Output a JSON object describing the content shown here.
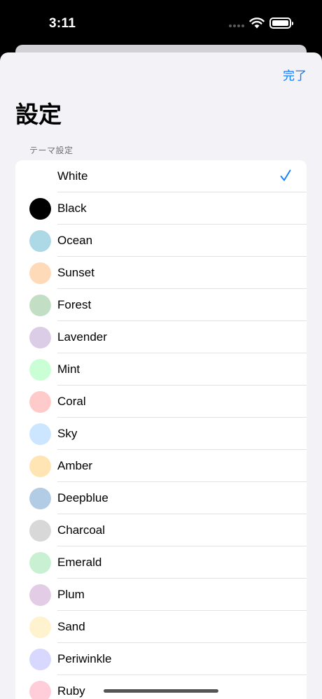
{
  "status_bar": {
    "time": "3:11"
  },
  "sheet": {
    "done_label": "完了",
    "title": "設定",
    "section_header": "テーマ設定"
  },
  "themes": [
    {
      "name": "White",
      "color": "#ffffff",
      "selected": true
    },
    {
      "name": "Black",
      "color": "#000000"
    },
    {
      "name": "Ocean",
      "color": "#add8e6"
    },
    {
      "name": "Sunset",
      "color": "#ffdab9"
    },
    {
      "name": "Forest",
      "color": "#c2dfc6"
    },
    {
      "name": "Lavender",
      "color": "#dccde6"
    },
    {
      "name": "Mint",
      "color": "#caffd6"
    },
    {
      "name": "Coral",
      "color": "#ffcaca"
    },
    {
      "name": "Sky",
      "color": "#cce6ff"
    },
    {
      "name": "Amber",
      "color": "#ffe5b4"
    },
    {
      "name": "Deepblue",
      "color": "#b3cce6"
    },
    {
      "name": "Charcoal",
      "color": "#d8d8d8"
    },
    {
      "name": "Emerald",
      "color": "#c9f0d2"
    },
    {
      "name": "Plum",
      "color": "#e3cce6"
    },
    {
      "name": "Sand",
      "color": "#fff3cf"
    },
    {
      "name": "Periwinkle",
      "color": "#d8d8ff"
    },
    {
      "name": "Ruby",
      "color": "#ffccd9"
    }
  ],
  "icons": {
    "checkmark": "checkmark-icon",
    "wifi": "wifi-icon",
    "battery": "battery-icon"
  },
  "accent_color": "#0a7aff"
}
